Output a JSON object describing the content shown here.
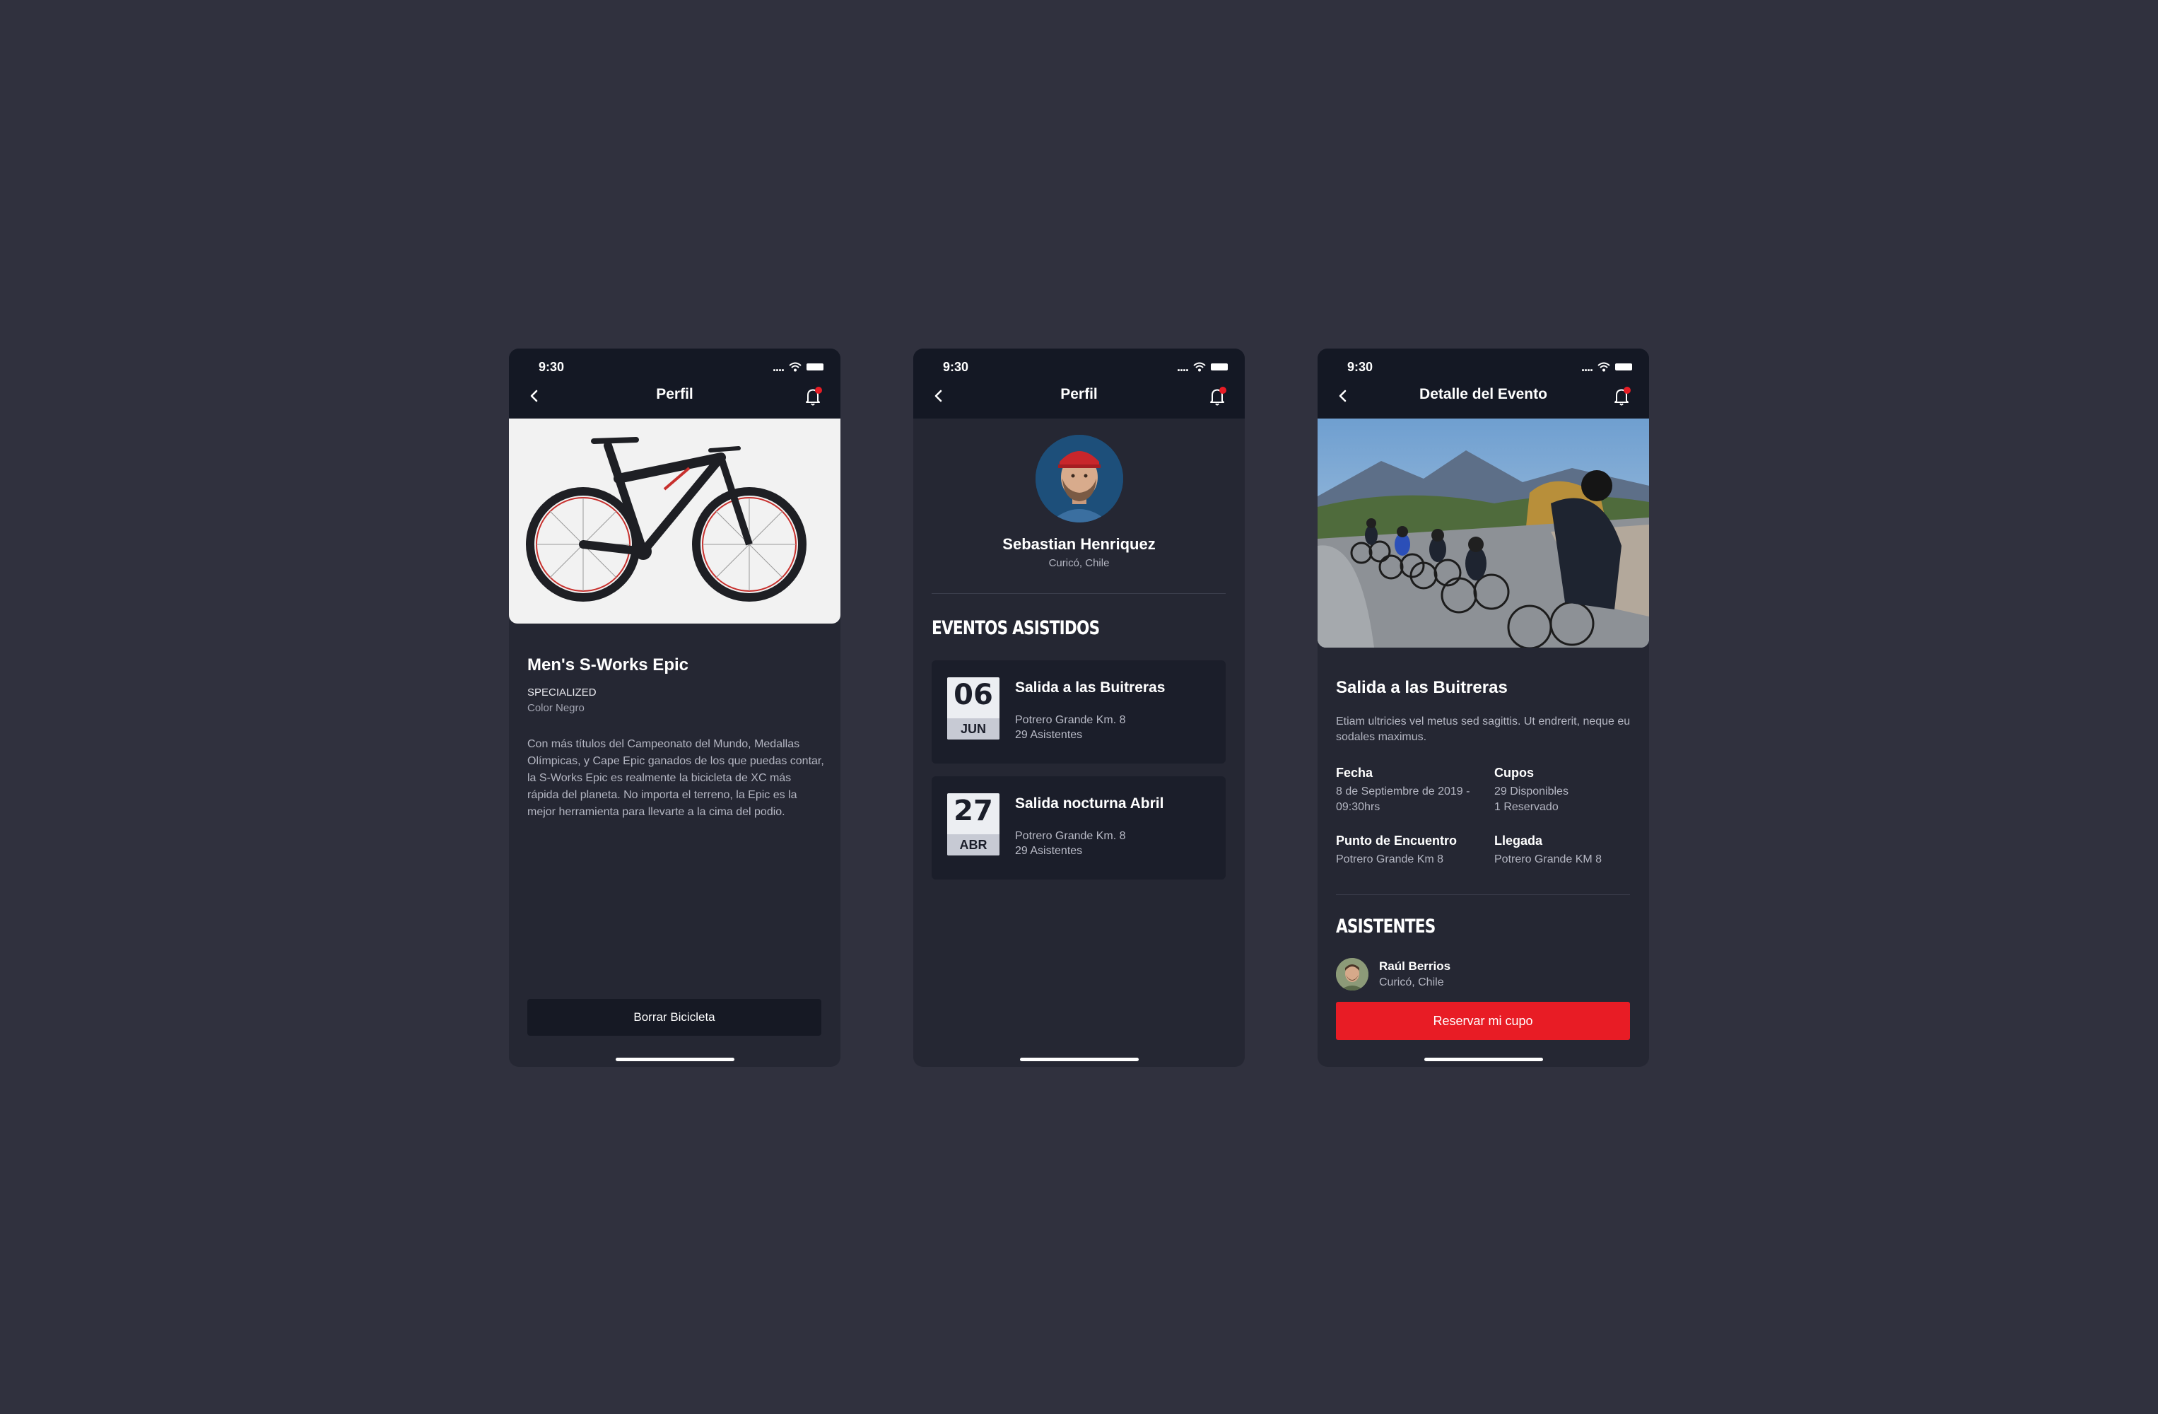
{
  "screen1": {
    "status_time": "9:30",
    "status_dots": "....",
    "title": "Perfil",
    "bike_name": "Men's S-Works Epic",
    "brand": "SPECIALIZED",
    "color": "Color Negro",
    "description": "Con más títulos del Campeonato del Mundo, Medallas Olímpicas, y Cape Epic ganados de los que puedas contar, la S-Works Epic es realmente la bicicleta de XC más rápida del planeta. No importa el terreno, la Epic es la mejor herramienta para llevarte a la cima del podio.",
    "delete_button": "Borrar Bicicleta"
  },
  "screen2": {
    "status_time": "9:30",
    "status_dots": "....",
    "title": "Perfil",
    "name": "Sebastian Henriquez",
    "location": "Curicó, Chile",
    "section_title": "EVENTOS ASISTIDOS",
    "events": [
      {
        "day": "06",
        "month": "JUN",
        "title": "Salida a las Buitreras",
        "place": "Potrero Grande Km. 8",
        "attendees": "29 Asistentes"
      },
      {
        "day": "27",
        "month": "ABR",
        "title": "Salida nocturna Abril",
        "place": "Potrero Grande Km. 8",
        "attendees": "29 Asistentes"
      }
    ]
  },
  "screen3": {
    "status_time": "9:30",
    "status_dots": "....",
    "title": "Detalle del Evento",
    "event_title": "Salida a las Buitreras",
    "event_desc": "Etiam ultricies vel metus sed sagittis. Ut endrerit, neque eu sodales maximus.",
    "fecha_label": "Fecha",
    "fecha_value": "8 de Septiembre de 2019 - 09:30hrs",
    "cupos_label": "Cupos",
    "cupos_available": "29 Disponibles",
    "cupos_reserved": "1 Reservado",
    "punto_label": "Punto de Encuentro",
    "punto_value": "Potrero Grande Km 8",
    "llegada_label": "Llegada",
    "llegada_value": "Potrero Grande KM 8",
    "section_title": "ASISTENTES",
    "attendee_name": "Raúl Berrios",
    "attendee_location": "Curicó, Chile",
    "reserve_button": "Reservar mi cupo"
  },
  "colors": {
    "background": "#30313e",
    "screen": "#252733",
    "bar": "#141824",
    "accent": "#e81c25"
  }
}
